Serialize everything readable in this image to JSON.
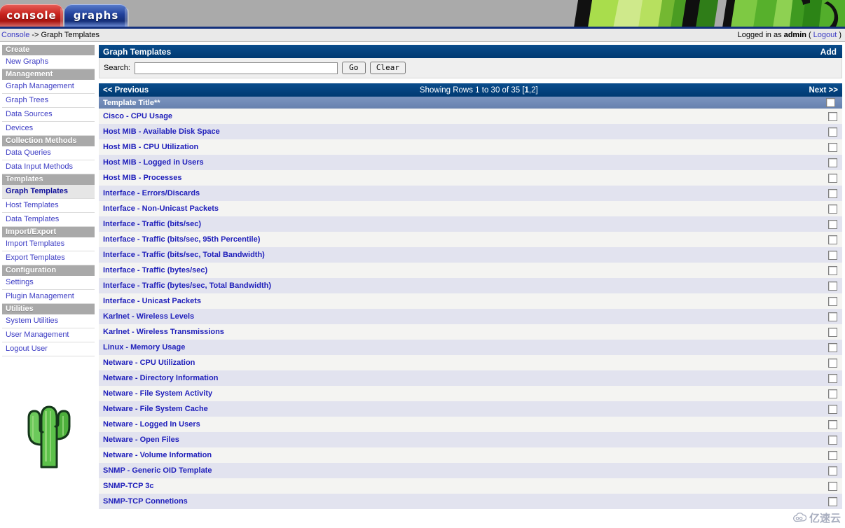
{
  "banner": {
    "tabs": [
      {
        "label": "console",
        "name": "tab-console",
        "active": true
      },
      {
        "label": "graphs",
        "name": "tab-graphs",
        "active": false
      }
    ],
    "graphic": "cactus-banner-graphic"
  },
  "breadcrumb": {
    "root": "Console",
    "separator": "->",
    "current": "Graph Templates",
    "logged_in_prefix": "Logged in as",
    "user": "admin",
    "logout_open": "(",
    "logout_label": "Logout",
    "logout_close": ")"
  },
  "sidebar": {
    "sections": [
      {
        "head": "Create",
        "items": [
          "New Graphs"
        ]
      },
      {
        "head": "Management",
        "items": [
          "Graph Management",
          "Graph Trees",
          "Data Sources",
          "Devices"
        ]
      },
      {
        "head": "Collection Methods",
        "items": [
          "Data Queries",
          "Data Input Methods"
        ]
      },
      {
        "head": "Templates",
        "items": [
          "Graph Templates",
          "Host Templates",
          "Data Templates"
        ]
      },
      {
        "head": "Import/Export",
        "items": [
          "Import Templates",
          "Export Templates"
        ]
      },
      {
        "head": "Configuration",
        "items": [
          "Settings",
          "Plugin Management"
        ]
      },
      {
        "head": "Utilities",
        "items": [
          "System Utilities",
          "User Management",
          "Logout User"
        ]
      }
    ],
    "selected_item": "Graph Templates",
    "logo": "cacti-cactus-logo"
  },
  "panel": {
    "title": "Graph Templates",
    "add_label": "Add"
  },
  "search": {
    "label": "Search:",
    "value": "",
    "placeholder": "",
    "go_label": "Go",
    "clear_label": "Clear"
  },
  "pager": {
    "previous_label": "<< Previous",
    "showing_prefix": "Showing Rows 1 to 30 of 35 [",
    "current_page": "1",
    "pages_rest": ",2]",
    "next_label": "Next >>"
  },
  "table": {
    "column_header": "Template Title**",
    "select_all_name": "select-all-checkbox",
    "rows": [
      {
        "title": "Cisco - CPU Usage"
      },
      {
        "title": "Host MIB - Available Disk Space"
      },
      {
        "title": "Host MIB - CPU Utilization"
      },
      {
        "title": "Host MIB - Logged in Users"
      },
      {
        "title": "Host MIB - Processes"
      },
      {
        "title": "Interface - Errors/Discards"
      },
      {
        "title": "Interface - Non-Unicast Packets"
      },
      {
        "title": "Interface - Traffic (bits/sec)"
      },
      {
        "title": "Interface - Traffic (bits/sec, 95th Percentile)"
      },
      {
        "title": "Interface - Traffic (bits/sec, Total Bandwidth)"
      },
      {
        "title": "Interface - Traffic (bytes/sec)"
      },
      {
        "title": "Interface - Traffic (bytes/sec, Total Bandwidth)"
      },
      {
        "title": "Interface - Unicast Packets"
      },
      {
        "title": "Karlnet - Wireless Levels"
      },
      {
        "title": "Karlnet - Wireless Transmissions"
      },
      {
        "title": "Linux - Memory Usage"
      },
      {
        "title": "Netware - CPU Utilization"
      },
      {
        "title": "Netware - Directory Information"
      },
      {
        "title": "Netware - File System Activity"
      },
      {
        "title": "Netware - File System Cache"
      },
      {
        "title": "Netware - Logged In Users"
      },
      {
        "title": "Netware - Open Files"
      },
      {
        "title": "Netware - Volume Information"
      },
      {
        "title": "SNMP - Generic OID Template"
      },
      {
        "title": "SNMP-TCP 3c"
      },
      {
        "title": "SNMP-TCP Connetions"
      }
    ]
  },
  "watermark": {
    "text": "亿速云",
    "icon": "cloud-icon"
  },
  "colors": {
    "header_blue": "#003a72",
    "col_header_blue": "#6a85b4",
    "link_blue": "#2020bb",
    "row_even": "#e2e3ef",
    "row_odd": "#f4f4f2",
    "menu_head_gray": "#a9a9a9",
    "banner_gray": "#aaaaaa",
    "rule_navy": "#13307c"
  }
}
